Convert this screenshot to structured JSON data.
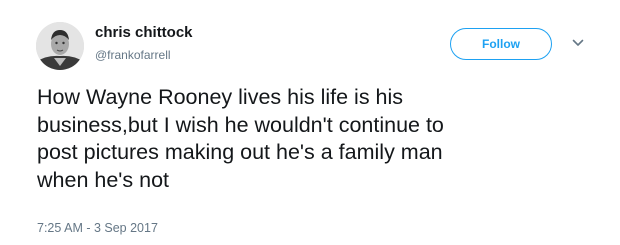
{
  "user": {
    "display_name": "chris chittock",
    "handle": "@frankofarrell",
    "avatar_icon": "profile-photo"
  },
  "actions": {
    "follow_label": "Follow",
    "menu_icon": "chevron-down-icon"
  },
  "tweet": {
    "lines": [
      "How Wayne Rooney lives his life is his",
      "business,but I wish he wouldn't continue to",
      "post pictures making out he's a family man",
      "when he's not"
    ],
    "timestamp": "7:25 AM - 3 Sep 2017"
  },
  "colors": {
    "accent": "#1da1f2",
    "text": "#14171a",
    "muted": "#657786"
  }
}
